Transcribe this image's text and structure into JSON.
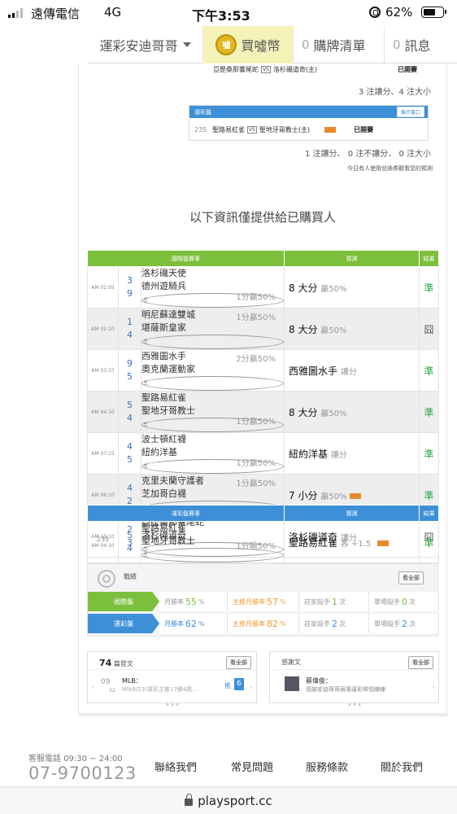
{
  "status_bar": {
    "carrier": "遠傳電信",
    "network": "4G",
    "time": "下午3:53",
    "battery": "62%"
  },
  "nav": {
    "user": "運彩安迪哥哥",
    "coin_icon": "噓",
    "coin": "買噓幣",
    "cart_count": "0",
    "cart": "購牌清單",
    "msg_count": "0",
    "msg": "訊息"
  },
  "top_match": {
    "home": "亞歷桑那響尾蛇",
    "vs": "VS",
    "away": "洛杉磯道奇(主)",
    "status": "已開賽"
  },
  "summary1": "3 注讓分、4 注大小",
  "lottery_box": {
    "title": "運彩盤",
    "button": "顯示盤口",
    "code": "235",
    "home": "聖路易紅雀",
    "vs": "VS",
    "away": "聖地牙哥教士(主)",
    "status": "已開賽"
  },
  "summary2": "1 注讓分、 0 注不讓分、 0 注大小",
  "note": "今日有人使用兌換券觀看您的預測",
  "buyer_title": "以下資訊僅提供給已購買人",
  "intl_table": {
    "headers": [
      "國際盤賽事",
      "預測",
      "結果"
    ],
    "rows": [
      {
        "time": "AM 02:05",
        "n1": "3",
        "t1": "洛杉磯天使",
        "n2": "9",
        "t2": "德州遊騎兵",
        "odds": "1分贏50%",
        "odds_pos": "bot",
        "pick": "8 大分",
        "note": "贏50%",
        "hot": false,
        "result": "準"
      },
      {
        "time": "AM 02:10",
        "n1": "1",
        "t1": "明尼蘇達雙城",
        "n2": "4",
        "t2": "堪薩斯皇家",
        "odds": "1分贏50%",
        "odds_pos": "top",
        "pick": "8 大分",
        "note": "贏50%",
        "hot": false,
        "result": "囧"
      },
      {
        "time": "AM 03:37",
        "n1": "9",
        "t1": "西雅圖水手",
        "n2": "5",
        "t2": "奧克蘭運動家",
        "odds": "2分贏50%",
        "odds_pos": "top",
        "pick": "西雅圖水手",
        "note": "讓分",
        "hot": false,
        "result": "準"
      },
      {
        "time": "AM 04:10",
        "n1": "5",
        "t1": "聖路易紅雀",
        "n2": "4",
        "t2": "聖地牙哥教士",
        "odds": "1分贏50%",
        "odds_pos": "bot",
        "pick": "8 大分",
        "note": "贏50%",
        "hot": false,
        "result": "準"
      },
      {
        "time": "AM 07:15",
        "n1": "4",
        "t1": "波士頓紅襪",
        "n2": "5",
        "t2": "紐約洋基",
        "odds": "1分贏50%",
        "odds_pos": "bot",
        "pick": "紐約洋基",
        "note": "讓分",
        "hot": false,
        "result": "準"
      },
      {
        "time": "AM 08:10",
        "n1": "4",
        "t1": "克里夫蘭守護者",
        "n2": "2",
        "t2": "芝加哥白襪",
        "odds": "1分贏50%",
        "odds_pos": "top",
        "pick": "7 小分",
        "note": "贏50%",
        "hot": true,
        "result": "準"
      },
      {
        "time": "AM 10:10",
        "n1": "2",
        "t1": "亞歷桑那響尾蛇",
        "n2": "3",
        "t2": "洛杉磯道奇",
        "odds": "1分輸50%",
        "odds_pos": "bot",
        "pick": "洛杉磯道奇",
        "note": "讓分",
        "hot": false,
        "result": "囧"
      }
    ]
  },
  "lottery_table": {
    "headers": [
      "運彩盤賽事",
      "預測",
      "結果"
    ],
    "row": {
      "code": "235",
      "time": "AM 04:10",
      "n1": "5",
      "t1": "聖路易紅雀",
      "n2": "4",
      "t2": "聖地牙哥教士",
      "pick": "聖路易紅雀",
      "note": "客 +1.5",
      "result": "準"
    }
  },
  "record": {
    "title": "戰績",
    "view_all": "看全部",
    "rows": [
      {
        "label": "國際盤",
        "month_label": "月勝率",
        "month": "55",
        "pct": "%",
        "main_label": "主推月勝率",
        "main": "57",
        "dealer_label": "莊家殺手",
        "dealer": "1",
        "single_label": "單場殺手",
        "single": "0",
        "times": "次"
      },
      {
        "label": "運彩盤",
        "month_label": "月勝率",
        "month": "62",
        "pct": "%",
        "main_label": "主推月勝率",
        "main": "82",
        "dealer_label": "莊家殺手",
        "dealer": "2",
        "single_label": "單場殺手",
        "single": "2",
        "times": "次"
      }
    ]
  },
  "posts": {
    "count": "74",
    "label": "篇發文",
    "view_all": "看全部",
    "date_month": "09",
    "date_day": "22",
    "league": "MLB：",
    "excerpt": "Mlb9/23(運彩主推17勝4敗...",
    "push": "推",
    "push_count": "6"
  },
  "thanks": {
    "label": "感謝文",
    "view_all": "看全部",
    "author": "蔡偉俊：",
    "text": "感謝安迪哥哥兩場運彩帶領練練"
  },
  "footer": {
    "phone_label": "客服電話 09:30 ~ 24:00",
    "phone": "07-9700123",
    "links": [
      "聯絡我們",
      "常見問題",
      "服務條款",
      "關於我們"
    ]
  },
  "url": "playsport.cc",
  "colors": {
    "green": "#7cbf3c",
    "blue": "#3d8fd8",
    "hit": "#2aa84a",
    "orange": "#f39a2b"
  }
}
